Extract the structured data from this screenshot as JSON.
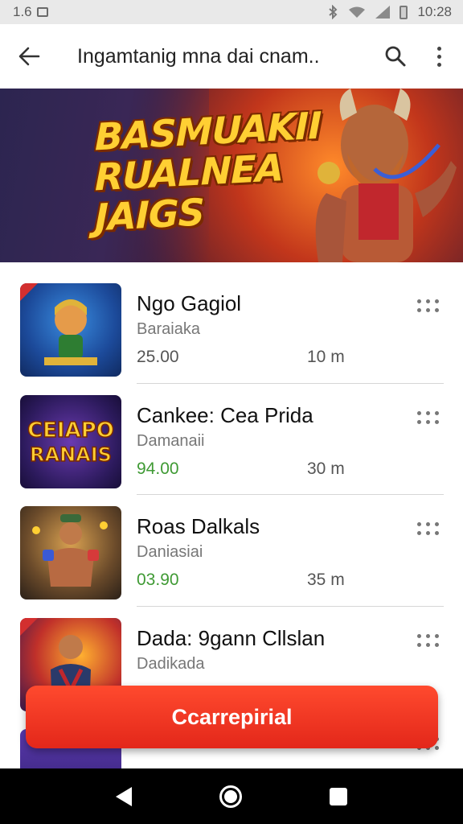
{
  "status_bar": {
    "left_text": "1.6",
    "time": "10:28"
  },
  "app_bar": {
    "title": "Ingamtanig mna dai cnam..",
    "back_icon": "arrow-back-icon",
    "search_icon": "search-icon",
    "more_icon": "more-vert-icon"
  },
  "banner": {
    "line1": "BASMUAKII",
    "line2": "RUALNEA",
    "line3": "JAIGS"
  },
  "games": [
    {
      "title": "Ngo Gagiol",
      "subtitle": "Baraiaka",
      "price": "25.00",
      "price_color": "#555555",
      "size": "10 m"
    },
    {
      "title": "Cankee: Cea Prida",
      "subtitle": "Damanaii",
      "price": "94.00",
      "price_color": "#3f9a34",
      "size": "30 m"
    },
    {
      "title": "Roas Dalkals",
      "subtitle": "Daniasiai",
      "price": "03.90",
      "price_color": "#3f9a34",
      "size": "35 m"
    },
    {
      "title": "Dada: 9gann Cllslan",
      "subtitle": "Dadikada",
      "price": "",
      "price_color": "#555555",
      "size": ""
    }
  ],
  "thumb_labels": {
    "game2": "CEIAPO",
    "game2b": "RANAIS"
  },
  "cta": {
    "label": "Ccarrepirial"
  },
  "colors": {
    "accent": "#e3271a",
    "green_price": "#3f9a34"
  }
}
